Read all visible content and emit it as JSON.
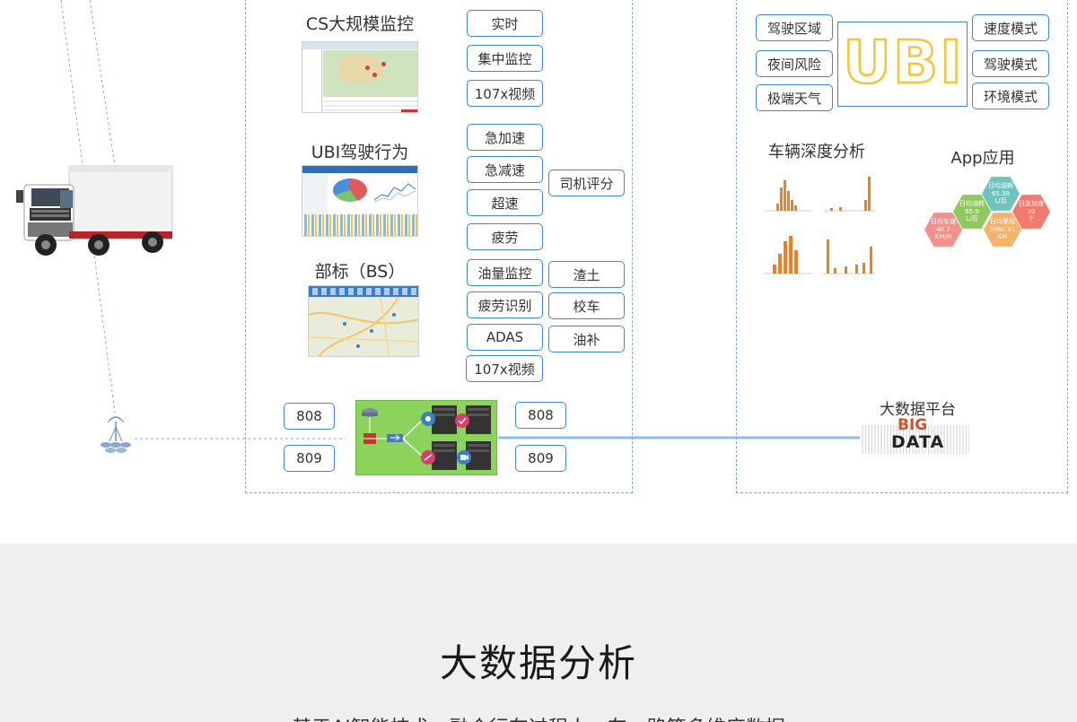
{
  "panel_left": {
    "cs": {
      "title": "CS大规模监控",
      "tags": [
        "实时",
        "集中监控",
        "107x视频"
      ]
    },
    "ubi": {
      "title": "UBI驾驶行为",
      "tags": [
        "急加速",
        "急减速",
        "超速",
        "疲劳"
      ],
      "side_tag": "司机评分"
    },
    "bs": {
      "title": "部标（BS）",
      "tags": [
        "油量监控",
        "疲劳识别",
        "ADAS",
        "107x视频"
      ],
      "side_tags": [
        "渣土",
        "校车",
        "油补"
      ]
    },
    "ports_left": [
      "808",
      "809"
    ],
    "ports_right": [
      "808",
      "809"
    ]
  },
  "panel_right": {
    "ubi_logo": "UBI",
    "ubi_left_tags": [
      "驾驶区域",
      "夜间风险",
      "极端天气"
    ],
    "ubi_right_tags": [
      "速度模式",
      "驾驶模式",
      "环境模式"
    ],
    "vehicle_analysis_title": "车辆深度分析",
    "app_title": "App应用",
    "app_hexes": [
      {
        "label": "日均油耗",
        "value": "65.38",
        "unit": "L/百",
        "color": "#6fc3bd"
      },
      {
        "label": "日急加速",
        "value": "30",
        "unit": "个",
        "color": "#f27a6c"
      },
      {
        "label": "日均油耗",
        "value": "65.9",
        "unit": "L/百",
        "color": "#8fc85e"
      },
      {
        "label": "日均车速",
        "value": "40.7",
        "unit": "KM/H",
        "color": "#f1918a"
      },
      {
        "label": "日均里程",
        "value": "3960.41",
        "unit": "KM",
        "color": "#f7b26a"
      }
    ],
    "big_data_title": "大数据平台",
    "big_data_logo": [
      "BIG",
      "DATA"
    ]
  },
  "bottom": {
    "heading": "大数据分析",
    "subtext": "基于AI智能技术，融合行车过程人、车、路等多维度数据"
  },
  "colors": {
    "tag_border": "#3f87cf",
    "panel_border": "#7aa7d8",
    "ubi_logo": "#f3c634",
    "bar_orange": "#f07f1d",
    "network_green": "#8bd35a",
    "link_line": "#8ebde8"
  },
  "icons": [
    "truck-icon",
    "antenna-icon",
    "router-icon",
    "firewall-icon",
    "switch-icon",
    "server-icon",
    "gear-icon",
    "shield-icon",
    "video-icon"
  ]
}
